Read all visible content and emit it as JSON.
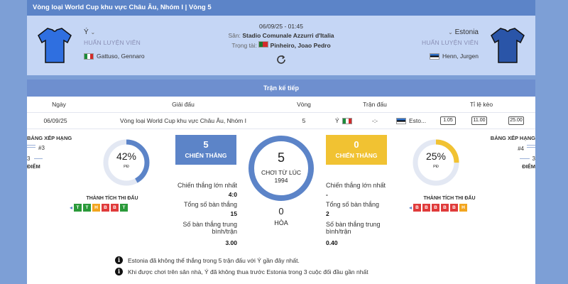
{
  "competition_title": "Vòng loại World Cup khu vực Châu Âu, Nhóm I | Vòng 5",
  "match": {
    "datetime": "06/09/25 - 01:45",
    "venue_label": "Sân:",
    "venue": "Stadio Comunale Azzurri d'Italia",
    "referee_label": "Trọng tài:",
    "referee": "Pinheiro, Joao Pedro"
  },
  "home": {
    "name": "Ý",
    "coach_label": "HUẤN LUYỆN VIÊN",
    "coach": "Gattuso, Gennaro",
    "shirt_color": "#2f6fe0"
  },
  "away": {
    "name": "Estonia",
    "coach_label": "HUẤN LUYỆN VIÊN",
    "coach": "Henn, Jurgen",
    "shirt_color": "#2a55a8"
  },
  "next_match": {
    "title": "Trận kế tiếp",
    "headers": {
      "date": "Ngày",
      "league": "Giải đấu",
      "round": "Vòng",
      "match": "Trận đấu",
      "odds": "Tỉ lệ kèo"
    },
    "row": {
      "date": "06/09/25",
      "league": "Vòng loại World Cup khu vực Châu Âu, Nhóm I",
      "round": "5",
      "home": "Ý",
      "score": "-:-",
      "away": "Esto...",
      "odds": [
        "1.05",
        "11.00",
        "25.00"
      ]
    }
  },
  "home_side": {
    "ranking_label": "BẢNG XẾP HẠNG",
    "rank": "#3",
    "points": "3",
    "points_label": "ĐIỂM",
    "pd_percent": "42%",
    "pd_value": 42,
    "pd_label": "PĐ",
    "form_title": "THÀNH TÍCH THI ĐẤU",
    "form": [
      "T",
      "T",
      "H",
      "B",
      "B",
      "T"
    ]
  },
  "away_side": {
    "ranking_label": "BẢNG XẾP HẠNG",
    "rank": "#4",
    "points": "3",
    "points_label": "ĐIỂM",
    "pd_percent": "25%",
    "pd_value": 25,
    "pd_label": "PĐ",
    "form_title": "THÀNH TÍCH THI ĐẤU",
    "form": [
      "B",
      "B",
      "B",
      "B",
      "B",
      "H"
    ]
  },
  "h2h": {
    "home_wins": "5",
    "home_wins_label": "CHIẾN THẮNG",
    "away_wins": "0",
    "away_wins_label": "CHIẾN THẮNG",
    "total_played": "5",
    "played_label": "CHƠI TỪ LÚC",
    "since_year": "1994",
    "draws": "0",
    "draws_label": "HÒA"
  },
  "home_stats": {
    "biggest_win_label": "Chiến thắng lớn nhất",
    "biggest_win": "4:0",
    "total_goals_label": "Tổng số bàn thắng",
    "total_goals": "15",
    "avg_goals_label": "Số bàn thắng trung bình/trận",
    "avg_goals": "3.00"
  },
  "away_stats": {
    "biggest_win_label": "Chiến thắng lớn nhất",
    "biggest_win": "-",
    "total_goals_label": "Tổng số bàn thắng",
    "total_goals": "2",
    "avg_goals_label": "Số bàn thắng trung bình/trận",
    "avg_goals": "0.40"
  },
  "notes": [
    "Estonia đã không thể thắng trong 5 trận đấu với Ý gần đây nhất.",
    "Khi được chơi trên sân nhà, Ý đã không thua trước Estonia trong 3 cuộc đối đầu gần nhất"
  ],
  "colors": {
    "win": "#2a9a3a",
    "draw": "#f2a51f",
    "loss": "#e03b3b",
    "home_box": "#5c84c8",
    "away_box": "#f1c232"
  }
}
